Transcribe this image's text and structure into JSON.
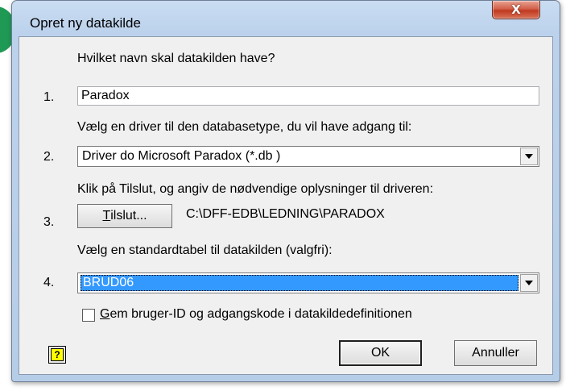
{
  "window": {
    "title": "Opret ny datakilde",
    "close_label": "X"
  },
  "steps": {
    "q1": "Hvilket navn skal datakilden have?",
    "n1": "1.",
    "name_value": "Paradox",
    "q2": "Vælg en driver til den databasetype, du vil have adgang til:",
    "n2": "2.",
    "driver_value": "Driver do Microsoft Paradox (*.db )",
    "q3": "Klik på Tilslut, og angiv de nødvendige oplysninger til driveren:",
    "n3": "3.",
    "connect_label_underlined": "T",
    "connect_label_rest": "ilslut...",
    "connect_path": "C:\\DFF-EDB\\LEDNING\\PARADOX",
    "q4": "Vælg en standardtabel til datakilden (valgfri):",
    "n4": "4.",
    "table_value": "BRUD06"
  },
  "checkbox": {
    "label_underlined": "G",
    "label_rest": "em bruger-ID og adgangskode i datakildedefinitionen",
    "checked": false
  },
  "buttons": {
    "help_label": "?",
    "ok_label": "OK",
    "cancel_label": "Annuller"
  }
}
